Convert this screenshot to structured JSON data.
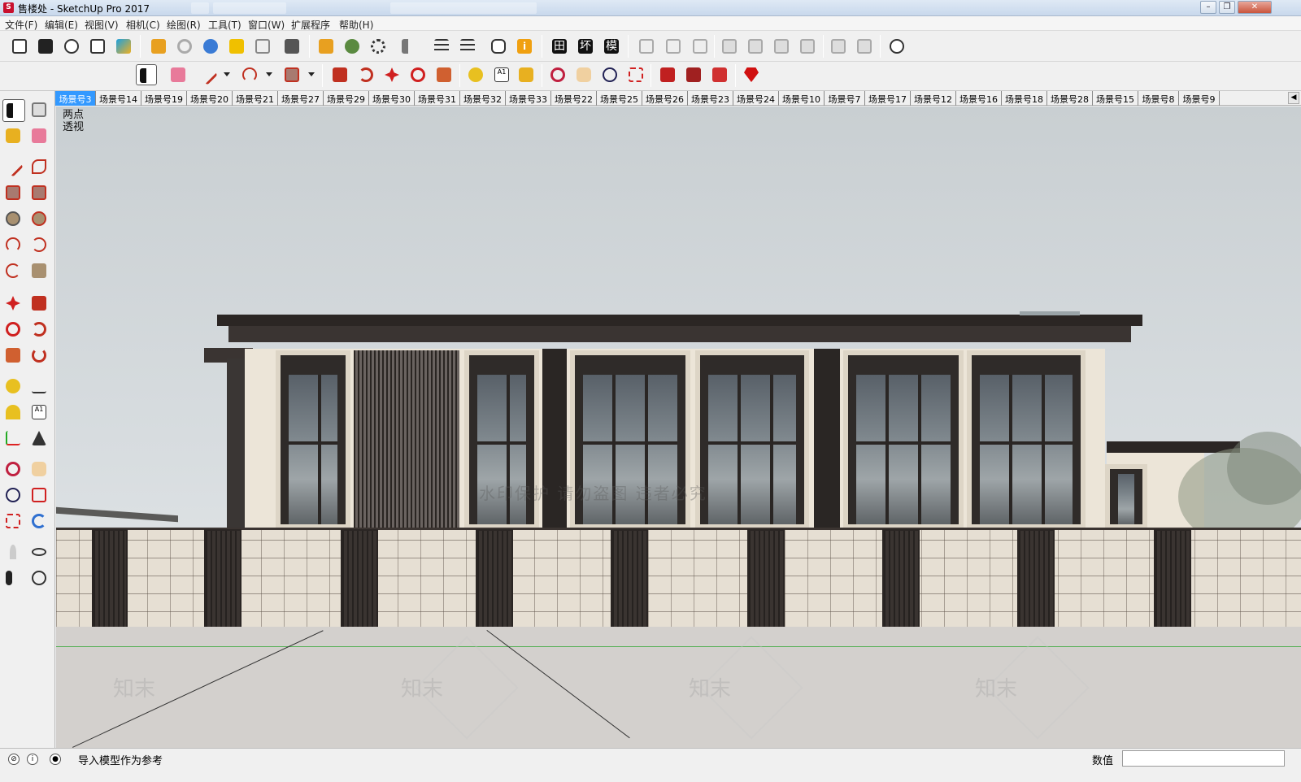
{
  "window": {
    "title": "售楼处 - SketchUp Pro 2017",
    "app_icon": "sketchup-icon",
    "controls": [
      "minimize",
      "restore",
      "close"
    ]
  },
  "menu": [
    "文件(F)",
    "编辑(E)",
    "视图(V)",
    "相机(C)",
    "绘图(R)",
    "工具(T)",
    "窗口(W)",
    "扩展程序",
    "帮助(H)"
  ],
  "toolbar_icons": {
    "plugins_text": [
      "田",
      "坏",
      "模"
    ]
  },
  "scenes": {
    "active": "场景号3",
    "tabs": [
      "场景号3",
      "场景号14",
      "场景号19",
      "场景号20",
      "场景号21",
      "场景号27",
      "场景号29",
      "场景号30",
      "场景号31",
      "场景号32",
      "场景号33",
      "场景号22",
      "场景号25",
      "场景号26",
      "场景号23",
      "场景号24",
      "场景号10",
      "场景号7",
      "场景号17",
      "场景号12",
      "场景号16",
      "场景号18",
      "场景号28",
      "场景号15",
      "场景号8",
      "场景号9"
    ]
  },
  "viewport": {
    "view_mode_line1": "两点",
    "view_mode_line2": "透视",
    "watermark_banner": "水印保护 请勿盗图 违者必究",
    "watermark_text": "知末"
  },
  "status": {
    "hint": "导入模型作为参考",
    "measurements_label": "数值",
    "measurements_value": ""
  }
}
